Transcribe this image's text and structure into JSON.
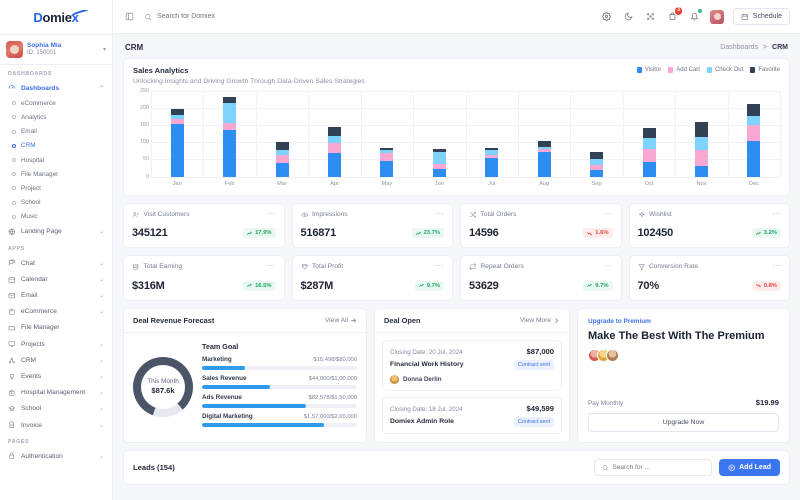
{
  "brand": {
    "name_a": "D",
    "name_b": "omie",
    "name_c": "x"
  },
  "sidebar": {
    "profile": {
      "name": "Sophia Mia",
      "id": "ID: 150001"
    },
    "sections": [
      {
        "heading": "DASHBOARDS",
        "items": [
          {
            "label": "Dashboards",
            "icon": "gauge-icon",
            "active": true,
            "expanded": true,
            "chevron": "⌃"
          },
          {
            "label": "eCommerce",
            "sub": true
          },
          {
            "label": "Analytics",
            "sub": true
          },
          {
            "label": "Email",
            "sub": true
          },
          {
            "label": "CRM",
            "sub": true,
            "active": true
          },
          {
            "label": "Hospital",
            "sub": true
          },
          {
            "label": "File Manager",
            "sub": true
          },
          {
            "label": "Project",
            "sub": true
          },
          {
            "label": "School",
            "sub": true
          },
          {
            "label": "Music",
            "sub": true
          },
          {
            "label": "Landing Page",
            "icon": "globe-icon",
            "chevron": "⌄"
          }
        ]
      },
      {
        "heading": "APPS",
        "items": [
          {
            "label": "Chat",
            "icon": "chat-icon",
            "chevron": "⌄"
          },
          {
            "label": "Calendar",
            "icon": "calendar-icon",
            "chevron": "⌄"
          },
          {
            "label": "Email",
            "icon": "mail-icon",
            "chevron": "⌄"
          },
          {
            "label": "eCommerce",
            "icon": "cart-icon",
            "chevron": "⌄"
          },
          {
            "label": "File Manager",
            "icon": "folder-icon",
            "chevron": ""
          },
          {
            "label": "Projects",
            "icon": "monitor-icon",
            "chevron": "⌄"
          },
          {
            "label": "CRM",
            "icon": "share-icon",
            "chevron": "⌄"
          },
          {
            "label": "Events",
            "icon": "trophy-icon",
            "chevron": "⌄"
          },
          {
            "label": "Hospital Management",
            "icon": "hospital-icon",
            "chevron": "⌄"
          },
          {
            "label": "School",
            "icon": "school-icon",
            "chevron": "⌄"
          },
          {
            "label": "Invoice",
            "icon": "invoice-icon",
            "chevron": "⌄"
          }
        ]
      },
      {
        "heading": "PAGES",
        "items": [
          {
            "label": "Authentication",
            "icon": "lock-icon",
            "chevron": "⌄"
          }
        ]
      }
    ]
  },
  "topbar": {
    "search_placeholder": "Search for Domiex",
    "search_value": "",
    "cart_badge": "3",
    "schedule_label": "Schedule"
  },
  "page": {
    "title": "CRM",
    "breadcrumb_root": "Dashboards",
    "breadcrumb_sep": ">",
    "breadcrumb_current": "CRM"
  },
  "chart_data": {
    "type": "bar",
    "title": "Sales Analytics",
    "subtitle": "Unlocking Insights and Driving Growth Through Data-Driven Sales Strategies",
    "xlabel": "",
    "ylabel": "",
    "ylim": [
      0,
      250
    ],
    "yticks": [
      0,
      50,
      100,
      150,
      200,
      250
    ],
    "grid": true,
    "legend_position": "top-right",
    "stacked": true,
    "categories": [
      "Jan",
      "Feb",
      "Mar",
      "Apr",
      "May",
      "Jun",
      "Jul",
      "Aug",
      "Sep",
      "Oct",
      "Nov",
      "Dec"
    ],
    "series": [
      {
        "name": "Visitor",
        "color": "#2e8df0",
        "values": [
          152,
          136,
          40,
          68,
          44,
          21,
          53,
          71,
          18,
          42,
          32,
          103
        ]
      },
      {
        "name": "Add Cart",
        "color": "#f9a8d4",
        "values": [
          14,
          21,
          22,
          29,
          25,
          14,
          9,
          9,
          16,
          37,
          44,
          48
        ]
      },
      {
        "name": "Check Out",
        "color": "#7dd3fc",
        "values": [
          12,
          56,
          15,
          20,
          7,
          36,
          15,
          5,
          17,
          33,
          40,
          25
        ]
      },
      {
        "name": "Favorite",
        "color": "#334155",
        "values": [
          19,
          17,
          24,
          26,
          6,
          8,
          5,
          19,
          21,
          30,
          43,
          34
        ]
      }
    ]
  },
  "stats": [
    {
      "label": "Visit Customers",
      "icon": "users-icon",
      "value": "345121",
      "delta": "17.9%",
      "dir": "up"
    },
    {
      "label": "Impressions",
      "icon": "eye-icon",
      "value": "516871",
      "delta": "23.7%",
      "dir": "up"
    },
    {
      "label": "Total Orders",
      "icon": "shuffle-icon",
      "value": "14596",
      "delta": "1.6%",
      "dir": "down"
    },
    {
      "label": "Wishlist",
      "icon": "sparkle-icon",
      "value": "102450",
      "delta": "3.2%",
      "dir": "up"
    },
    {
      "label": "Total Earning",
      "icon": "coins-icon",
      "value": "$316M",
      "delta": "16.5%",
      "dir": "up"
    },
    {
      "label": "Total Profit",
      "icon": "gem-icon",
      "value": "$287M",
      "delta": "9.7%",
      "dir": "up"
    },
    {
      "label": "Repeat Orders",
      "icon": "repeat-icon",
      "value": "53629",
      "delta": "9.7%",
      "dir": "up"
    },
    {
      "label": "Conversion Rate",
      "icon": "funnel-icon",
      "value": "70%",
      "delta": "0.8%",
      "dir": "down"
    }
  ],
  "deal_revenue": {
    "title": "Deal Revenue Forecast",
    "view_all": "View All",
    "donut_label": "This Month",
    "donut_value": "$87.6k",
    "donut_percent": 83,
    "goals_title": "Team Goal",
    "goals": [
      {
        "name": "Marketing",
        "amount": "$15,498/$80,000",
        "percent": 28
      },
      {
        "name": "Sales Revenue",
        "amount": "$44,000/$1,00,000",
        "percent": 44
      },
      {
        "name": "Ads Revenue",
        "amount": "$82,578/$1,50,000",
        "percent": 67
      },
      {
        "name": "Digital Marketing",
        "amount": "$1,57,000/$2,00,000",
        "percent": 79
      }
    ]
  },
  "deal_open": {
    "title": "Deal Open",
    "view_more": "View More",
    "items": [
      {
        "date": "Closing Date: 20 Jul, 2024",
        "amount": "$87,000",
        "name": "Financial Work History",
        "tag": "Contract sent",
        "person": "Donna Derlin"
      },
      {
        "date": "Closing Date: 18 Jul, 2024",
        "amount": "$49,599",
        "name": "Domiex Admin Role",
        "tag": "Contract sent",
        "person": ""
      }
    ]
  },
  "premium": {
    "kicker": "Upgrade to Premium",
    "title": "Make The Best With The Premium",
    "pay_label": "Pay Monthly",
    "price": "$19.99",
    "button": "Upgrade Now"
  },
  "leads": {
    "title": "Leads (154)",
    "search_placeholder": "Search for ...",
    "search_value": "",
    "add_label": "Add Lead"
  },
  "colors": {
    "accent": "#3b76f0",
    "up": "#1fa463",
    "down": "#e8453c"
  }
}
